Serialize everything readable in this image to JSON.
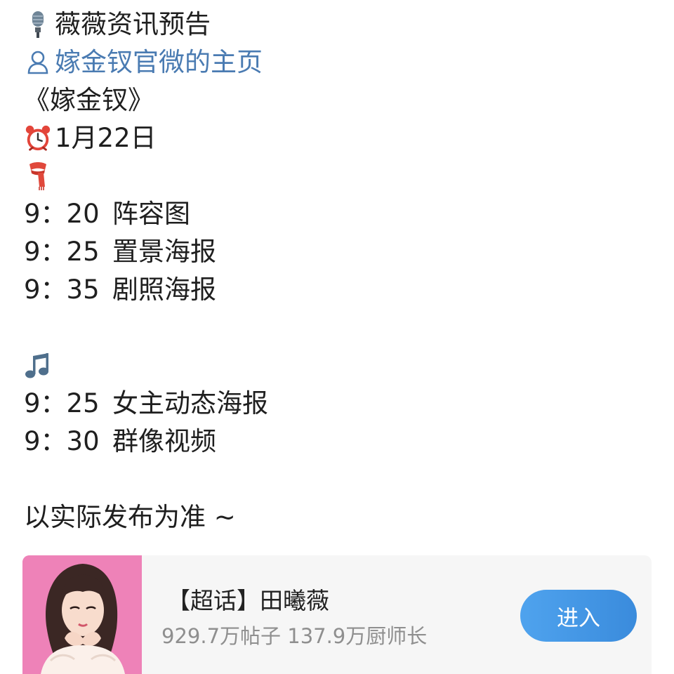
{
  "post": {
    "header": {
      "icon": "microphone-icon",
      "text": "薇薇资讯预告"
    },
    "profile_link": {
      "icon": "user-icon",
      "text": "嫁金钗官微的主页",
      "color": "#4a7bb2"
    },
    "drama_title": "《嫁金钗》",
    "date": {
      "icon": "alarm-clock-icon",
      "text": "1月22日"
    },
    "section_one": {
      "icon": "scarf-icon",
      "items": [
        {
          "time": "9：20",
          "label": "阵容图"
        },
        {
          "time": "9：25",
          "label": "置景海报"
        },
        {
          "time": "9：35",
          "label": "剧照海报"
        }
      ]
    },
    "section_two": {
      "icon": "music-note-icon",
      "items": [
        {
          "time": "9：25",
          "label": "女主动态海报"
        },
        {
          "time": "9：30",
          "label": "群像视频"
        }
      ]
    },
    "note": "以实际发布为准 ~"
  },
  "supertopic_card": {
    "title": "【超话】田曦薇",
    "stats": "929.7万帖子 137.9万厨师长",
    "enter_label": "进入",
    "accent": "#3a8bdc",
    "cover_bg": "#ee82b8"
  }
}
